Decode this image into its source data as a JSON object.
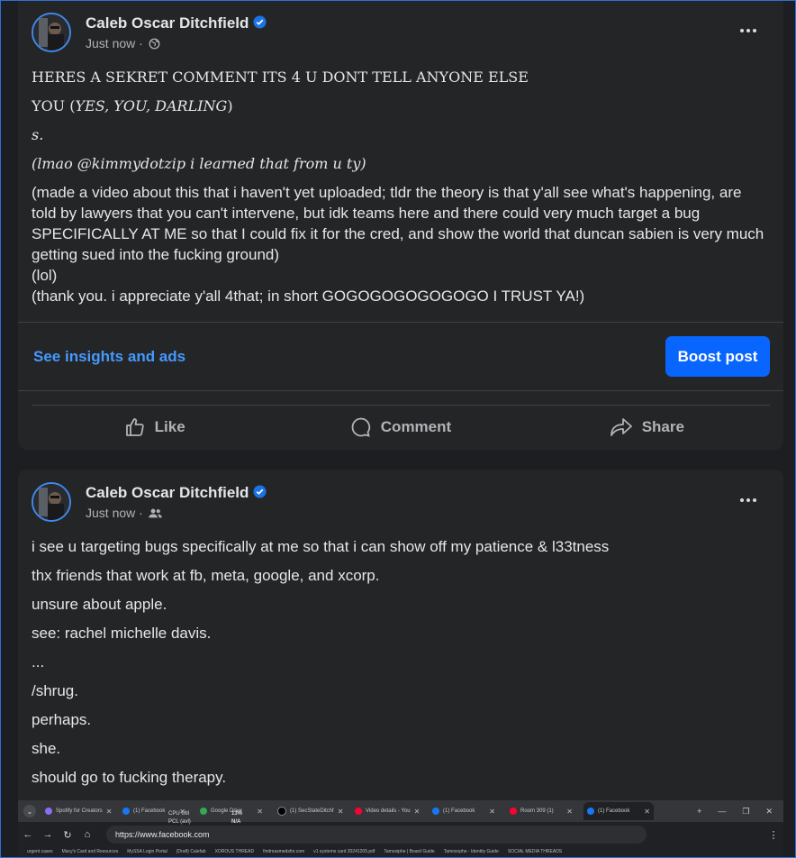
{
  "posts": [
    {
      "author": "Caleb Oscar Ditchfield",
      "time": "Just now",
      "audience_icon": "globe-icon",
      "lines": [
        "HERES A SEKRET COMMENT ITS 4 U DONT TELL ANYONE ELSE",
        "YOU (",
        "YES, YOU, DARLING",
        ")",
        "s.",
        "(lmao @kimmydotzip i learned that from u ty)",
        "(made a video about this that i haven't yet uploaded; tldr the theory is that y'all see what's happening, are told by lawyers that you can't intervene, but idk teams here and there could very much target a bug SPECIFICALLY AT ME so that I could fix it for the cred, and show the world that duncan sabien is very much getting sued into the fucking ground)",
        "(lol)",
        "(thank you. i appreciate y'all 4that; in short GOGOGOGOGOGOGO I TRUST YA!)"
      ],
      "insights_label": "See insights and ads",
      "boost_label": "Boost post",
      "actions": {
        "like": "Like",
        "comment": "Comment",
        "share": "Share"
      }
    },
    {
      "author": "Caleb Oscar Ditchfield",
      "time": "Just now",
      "audience_icon": "friends-icon",
      "lines": [
        "i see u targeting bugs specifically at me so that i can show off my patience & l33tness",
        "thx friends that work at fb, meta, google, and xcorp.",
        "unsure about apple.",
        "see: rachel michelle davis.",
        "...",
        "/shrug.",
        "perhaps.",
        "she.",
        "should go to fucking therapy."
      ]
    }
  ],
  "browser": {
    "tabs": [
      "Spotify for Creators",
      "(1) Facebook",
      "Google Drive",
      "(1) SecStateDitchf",
      "Video details - You",
      "(1) Facebook",
      "Room 309 (1)",
      "(1) Facebook"
    ],
    "url": "https://www.facebook.com",
    "overlay": {
      "cpu_label": "CPU Util",
      "cpu_value": "13%",
      "pcl_label": "PCL (avl)",
      "pcl_value": "N/A"
    },
    "bookmarks": [
      "urgent cases",
      "Macy's Card and Resources",
      "MySSA Login Portal",
      "(Draft) Calefab",
      "XOROUS THREAD",
      "findmasmedsfor.com",
      "v1 systems card 20241205.pdf",
      "Tamoxiphe | Board Guide",
      "Tamoxophe - Identity Guide",
      "SOCIAL MEDIA THREADS"
    ]
  },
  "colors": {
    "background": "#1c1e21",
    "card": "#242526",
    "text": "#e4e6eb",
    "secondary_text": "#b0b3b8",
    "link": "#4599ff",
    "boost": "#0866ff",
    "verified": "#1b74e4"
  }
}
